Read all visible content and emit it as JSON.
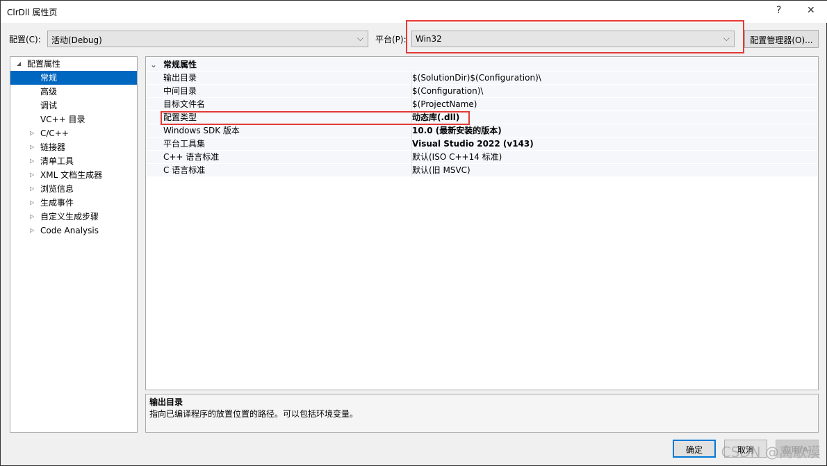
{
  "window": {
    "title": "ClrDll 属性页",
    "help": "?",
    "close": "✕"
  },
  "config": {
    "label": "配置(C):",
    "value": "活动(Debug)"
  },
  "platform": {
    "label": "平台(P):",
    "value": "Win32"
  },
  "config_manager": "配置管理器(O)...",
  "tree": {
    "root": "配置属性",
    "items": [
      {
        "label": "常规",
        "selected": true,
        "expandable": false
      },
      {
        "label": "高级",
        "expandable": false
      },
      {
        "label": "调试",
        "expandable": false
      },
      {
        "label": "VC++ 目录",
        "expandable": false
      },
      {
        "label": "C/C++",
        "expandable": true
      },
      {
        "label": "链接器",
        "expandable": true
      },
      {
        "label": "清单工具",
        "expandable": true
      },
      {
        "label": "XML 文档生成器",
        "expandable": true
      },
      {
        "label": "浏览信息",
        "expandable": true
      },
      {
        "label": "生成事件",
        "expandable": true
      },
      {
        "label": "自定义生成步骤",
        "expandable": true
      },
      {
        "label": "Code Analysis",
        "expandable": true
      }
    ]
  },
  "grid": {
    "section": "常规属性",
    "rows": [
      {
        "name": "输出目录",
        "value": "$(SolutionDir)$(Configuration)\\",
        "bold": false
      },
      {
        "name": "中间目录",
        "value": "$(Configuration)\\",
        "bold": false
      },
      {
        "name": "目标文件名",
        "value": "$(ProjectName)",
        "bold": false
      },
      {
        "name": "配置类型",
        "value": "动态库(.dll)",
        "bold": true
      },
      {
        "name": "Windows SDK 版本",
        "value": "10.0 (最新安装的版本)",
        "bold": true
      },
      {
        "name": "平台工具集",
        "value": "Visual Studio 2022 (v143)",
        "bold": true
      },
      {
        "name": "C++ 语言标准",
        "value": "默认(ISO C++14 标准)",
        "bold": false
      },
      {
        "name": "C 语言标准",
        "value": "默认(旧 MSVC)",
        "bold": false
      }
    ]
  },
  "description": {
    "title": "输出目录",
    "text": "指向已编译程序的放置位置的路径。可以包括环境变量。"
  },
  "buttons": {
    "ok": "确定",
    "cancel": "取消",
    "apply": "应用(A)"
  },
  "watermark": "CSDN @离歌漠",
  "colors": {
    "highlight": "#e53935",
    "selection": "#0067c0"
  }
}
